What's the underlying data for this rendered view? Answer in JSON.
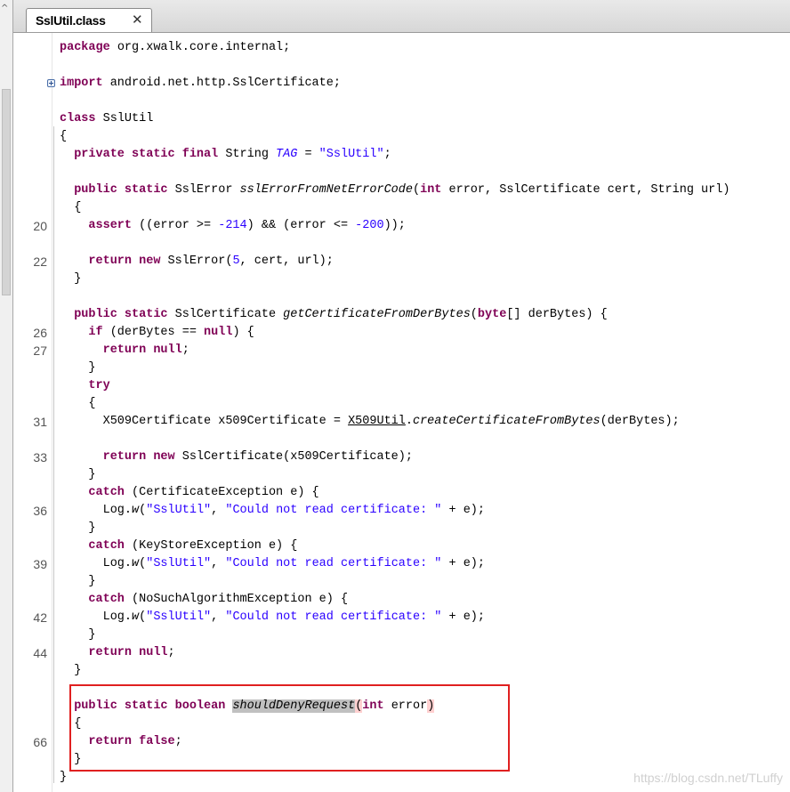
{
  "tab": {
    "label": "SslUtil.class",
    "close_icon": "close-icon"
  },
  "lines": [
    {
      "text": "package org.xwalk.core.internal;"
    },
    {
      "text": "import android.net.http.SslCertificate;"
    },
    {
      "text": "class SslUtil"
    },
    {
      "text": "{"
    },
    {
      "text": "  private static final String TAG = \"SslUtil\";"
    },
    {
      "text": "  public static SslError sslErrorFromNetErrorCode(int error, SslCertificate cert, String url)"
    },
    {
      "text": "  {"
    },
    {
      "ln": "20",
      "text": "    assert ((error >= -214) && (error <= -200));"
    },
    {
      "ln": "22",
      "text": "    return new SslError(5, cert, url);"
    },
    {
      "text": "  }"
    },
    {
      "text": "  public static SslCertificate getCertificateFromDerBytes(byte[] derBytes) {"
    },
    {
      "ln": "26",
      "text": "    if (derBytes == null) {"
    },
    {
      "ln": "27",
      "text": "      return null;"
    },
    {
      "text": "    }"
    },
    {
      "text": "    try"
    },
    {
      "text": "    {"
    },
    {
      "ln": "31",
      "text": "      X509Certificate x509Certificate = X509Util.createCertificateFromBytes(derBytes);"
    },
    {
      "ln": "33",
      "text": "      return new SslCertificate(x509Certificate);"
    },
    {
      "text": "    }"
    },
    {
      "text": "    catch (CertificateException e) {"
    },
    {
      "ln": "36",
      "text": "      Log.w(\"SslUtil\", \"Could not read certificate: \" + e);"
    },
    {
      "text": "    }"
    },
    {
      "text": "    catch (KeyStoreException e) {"
    },
    {
      "ln": "39",
      "text": "      Log.w(\"SslUtil\", \"Could not read certificate: \" + e);"
    },
    {
      "text": "    }"
    },
    {
      "text": "    catch (NoSuchAlgorithmException e) {"
    },
    {
      "ln": "42",
      "text": "      Log.w(\"SslUtil\", \"Could not read certificate: \" + e);"
    },
    {
      "text": "    }"
    },
    {
      "ln": "44",
      "text": "    return null;"
    },
    {
      "text": "  }"
    },
    {
      "text": "  public static boolean shouldDenyRequest(int error)"
    },
    {
      "text": "  {"
    },
    {
      "ln": "66",
      "text": "    return false;"
    },
    {
      "text": "  }"
    },
    {
      "text": "}"
    }
  ],
  "watermark": "https://blog.csdn.net/TLuffy"
}
